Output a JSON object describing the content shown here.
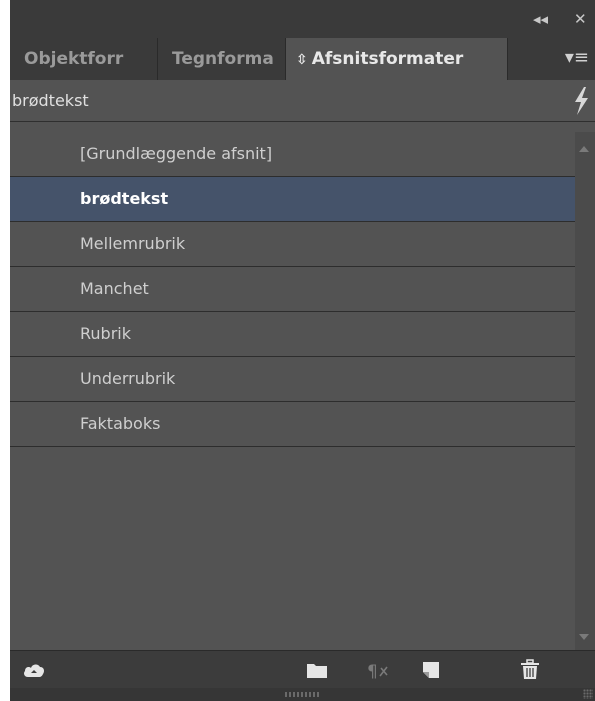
{
  "window": {
    "collapse_glyph": "◂◂",
    "close_glyph": "✕"
  },
  "tabs": [
    {
      "label": "Objektforr",
      "active": false
    },
    {
      "label": "Tegnforma",
      "active": false
    },
    {
      "label": "Afsnitsformater",
      "active": true
    }
  ],
  "tab_menu_glyph": "▾≡",
  "current_style": {
    "name": "brødtekst",
    "action_icon": "lightning-icon"
  },
  "styles": [
    {
      "label": "[Grundlæggende afsnit]",
      "selected": false
    },
    {
      "label": "brødtekst",
      "selected": true
    },
    {
      "label": "Mellemrubrik",
      "selected": false
    },
    {
      "label": "Manchet",
      "selected": false
    },
    {
      "label": "Rubrik",
      "selected": false
    },
    {
      "label": "Underrubrik",
      "selected": false
    },
    {
      "label": "Faktaboks",
      "selected": false
    }
  ],
  "toolbar": {
    "icons": [
      "cloud-library-icon",
      "folder-icon",
      "clear-overrides-icon",
      "new-style-icon",
      "trash-icon"
    ]
  },
  "colors": {
    "panel_bg": "#535353",
    "header_bg": "#3a3a3a",
    "selection": "#45536a",
    "text": "#cfcfcf"
  }
}
